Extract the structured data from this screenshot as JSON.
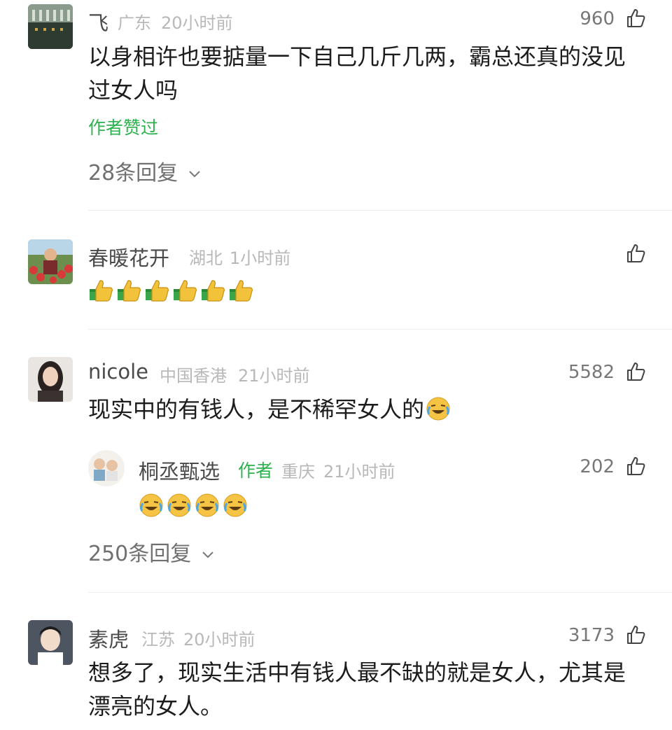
{
  "comments": [
    {
      "nickname": "飞",
      "location": "广东",
      "time": "20小时前",
      "likes": "960",
      "text_line1": "以身相许也要掂量一下自己几斤几两，霸总还真的没见",
      "text_line2": "过女人吗",
      "liked_by_author": "作者赞过",
      "replies": "28条回复"
    },
    {
      "nickname": "春暖花开",
      "location": "湖北",
      "time": "1小时前",
      "likes": "",
      "emoji_text": [
        "thumbs-up",
        "thumbs-up",
        "thumbs-up",
        "thumbs-up",
        "thumbs-up",
        "thumbs-up"
      ]
    },
    {
      "nickname": "nicole",
      "location": "中国香港",
      "time": "21小时前",
      "likes": "5582",
      "text": "现实中的有钱人，是不稀罕女人的",
      "reply": {
        "nickname": "桐丞甄选",
        "author_tag": "作者",
        "location": "重庆",
        "time": "21小时前",
        "likes": "202",
        "emoji_text": [
          "laugh-cry",
          "laugh-cry",
          "laugh-cry",
          "laugh-cry"
        ]
      },
      "replies": "250条回复"
    },
    {
      "nickname": "素虎",
      "location": "江苏",
      "time": "20小时前",
      "likes": "3173",
      "text_line1": "想多了，现实生活中有钱人最不缺的就是女人，尤其是",
      "text_line2": "漂亮的女人。"
    }
  ],
  "colors": {
    "green": "#2bb24c",
    "meta": "#b8b8b8",
    "divider": "#ececec"
  },
  "icons": {
    "like": "thumbs-up-outline-icon",
    "expand": "chevron-down-icon"
  }
}
